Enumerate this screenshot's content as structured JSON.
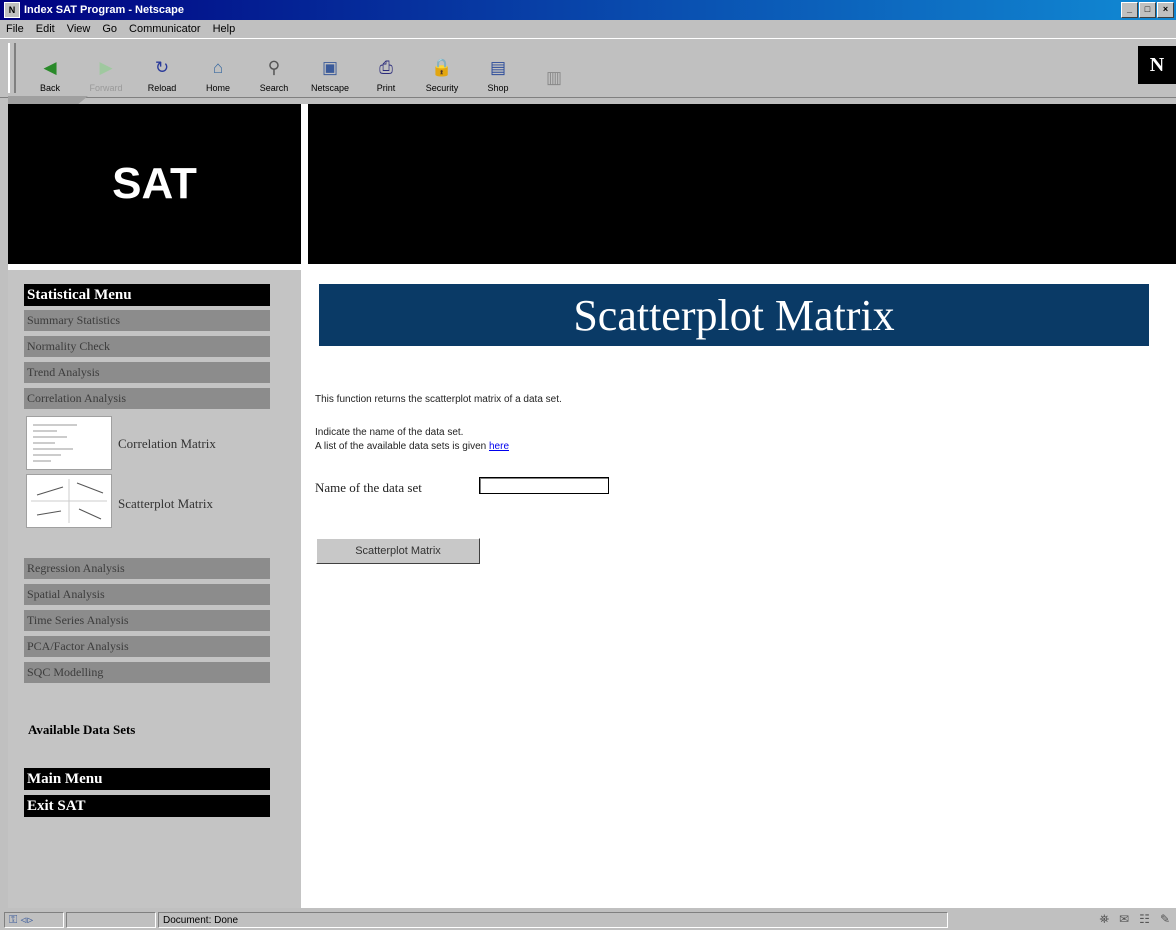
{
  "window": {
    "title": "Index SAT Program - Netscape",
    "controls": [
      "_",
      "□",
      "×"
    ]
  },
  "menubar": [
    "File",
    "Edit",
    "View",
    "Go",
    "Communicator",
    "Help"
  ],
  "toolbar": {
    "buttons": [
      {
        "label": "Back",
        "icon": "back-arrow-icon",
        "glyph": "◀",
        "color": "#2a8a2a"
      },
      {
        "label": "Forward",
        "icon": "forward-arrow-icon",
        "glyph": "▶",
        "color": "#9fc89f"
      },
      {
        "label": "Reload",
        "icon": "reload-icon",
        "glyph": "↻",
        "color": "#2a3a9a"
      },
      {
        "label": "Home",
        "icon": "home-icon",
        "glyph": "⌂",
        "color": "#3a6aa0"
      },
      {
        "label": "Search",
        "icon": "search-icon",
        "glyph": "⚲",
        "color": "#555555"
      },
      {
        "label": "Netscape",
        "icon": "netscape-icon",
        "glyph": "▣",
        "color": "#3a5a9a"
      },
      {
        "label": "Print",
        "icon": "print-icon",
        "glyph": "⎙",
        "color": "#2a2a7a"
      },
      {
        "label": "Security",
        "icon": "security-lock-icon",
        "glyph": "🔒",
        "color": "#aa2a2a"
      },
      {
        "label": "Shop",
        "icon": "shop-icon",
        "glyph": "▤",
        "color": "#2a4a9a"
      },
      {
        "label": "",
        "icon": "stop-icon",
        "glyph": "▥",
        "color": "#888888"
      }
    ],
    "logo": "N"
  },
  "page": {
    "logo_text": "SAT",
    "sidebar": {
      "header": "Statistical Menu",
      "items_top": [
        "Summary Statistics",
        "Normality Check",
        "Trend Analysis",
        "Correlation Analysis"
      ],
      "sub_items": [
        "Correlation Matrix",
        "Scatterplot Matrix"
      ],
      "items_bottom": [
        "Regression Analysis",
        "Spatial Analysis",
        "Time Series Analysis",
        "PCA/Factor Analysis",
        "SQC Modelling"
      ],
      "available": "Available Data Sets",
      "main_menu": "Main Menu",
      "exit": "Exit SAT"
    },
    "main": {
      "title": "Scatterplot Matrix",
      "description": "This function returns the scatterplot matrix of a data set.",
      "instruction": "Indicate the name of the data set.",
      "list_text": "A list of the available data sets is given ",
      "list_link": "here",
      "field_label": "Name of the data set",
      "field_value": "",
      "button_label": "Scatterplot Matrix"
    }
  },
  "statusbar": {
    "text": "Document: Done"
  },
  "colors": {
    "title_banner": "#0a3a66",
    "sidebar_bg": "#c4c4c4",
    "menu_item_bg": "#8c8c8c",
    "link": "#0000ee"
  }
}
